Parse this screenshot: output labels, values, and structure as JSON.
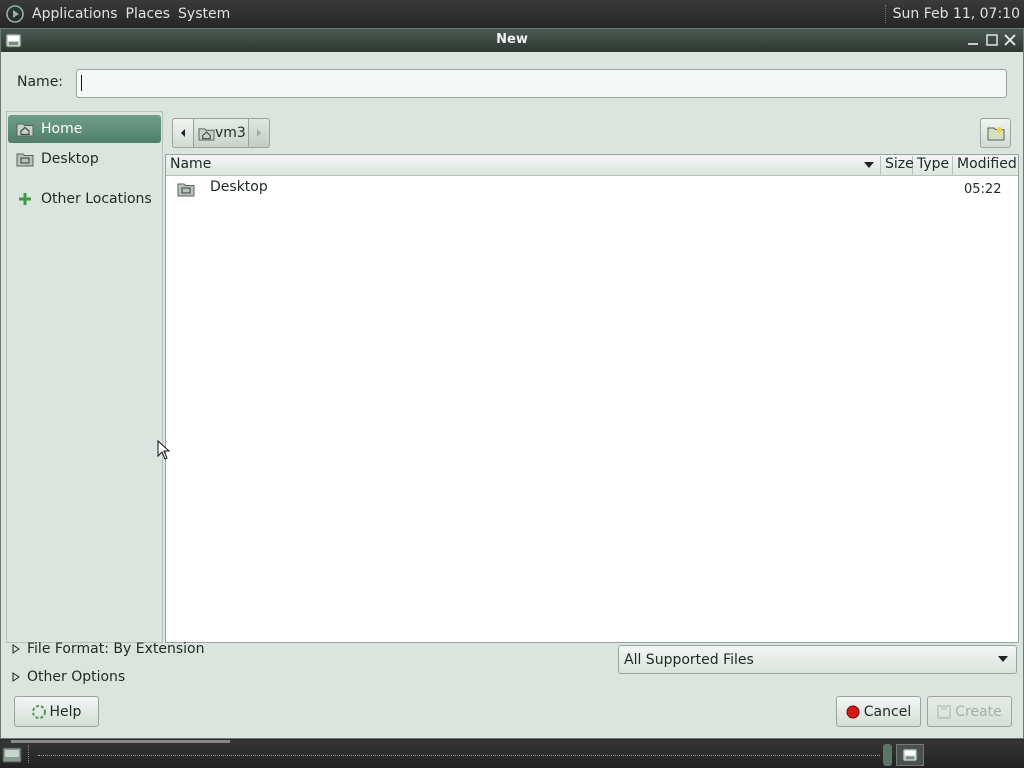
{
  "top_panel": {
    "menus": [
      "Applications",
      "Places",
      "System"
    ],
    "clock": "Sun Feb 11, 07:10"
  },
  "window": {
    "title": "New"
  },
  "name_field": {
    "label": "Name:",
    "value": ""
  },
  "sidebar": {
    "items": [
      {
        "label": "Home",
        "icon": "home-folder-icon",
        "selected": true
      },
      {
        "label": "Desktop",
        "icon": "desktop-folder-icon",
        "selected": false
      },
      {
        "label": "Other Locations",
        "icon": "plus-icon",
        "selected": false
      }
    ]
  },
  "path_bar": {
    "current": "vm3"
  },
  "file_list": {
    "columns": [
      "Name",
      "Size",
      "Type",
      "Modified"
    ],
    "sort_column": "Name",
    "rows": [
      {
        "name": "Desktop",
        "size": "",
        "type": "",
        "modified": "05:22",
        "icon": "folder-icon"
      }
    ]
  },
  "expanders": {
    "file_format": "File Format: By Extension",
    "other_options": "Other Options"
  },
  "filter": {
    "selected": "All Supported Files"
  },
  "buttons": {
    "help": "Help",
    "cancel": "Cancel",
    "create": "Create"
  },
  "colors": {
    "window_bg": "#dce4df",
    "selection": "#5e8d78",
    "titlebar": "#3b463f",
    "panel": "#2c2c2c"
  }
}
